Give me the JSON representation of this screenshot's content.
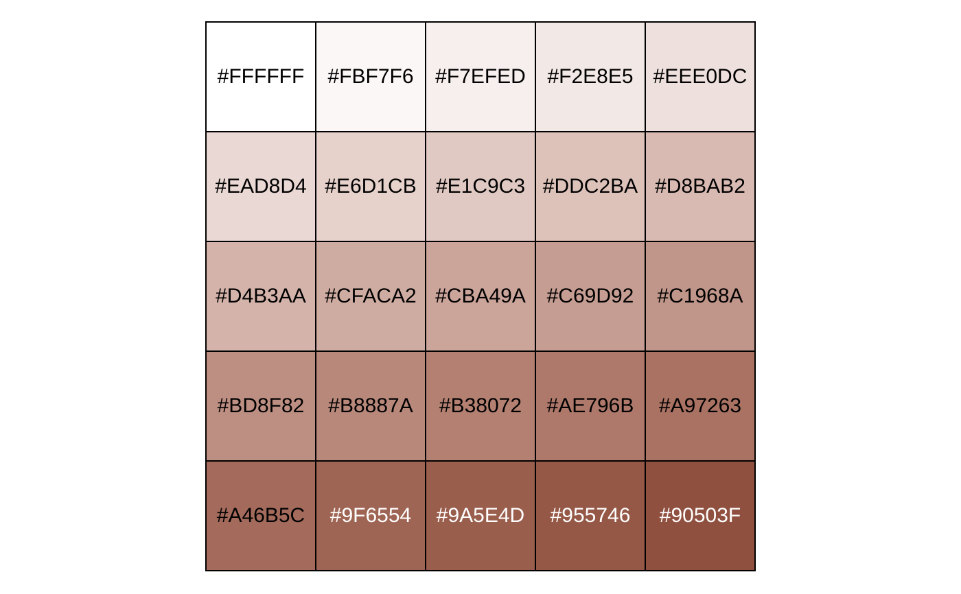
{
  "palette": {
    "swatches": [
      {
        "hex": "#FFFFFF",
        "text_color": "#000000"
      },
      {
        "hex": "#FBF7F6",
        "text_color": "#000000"
      },
      {
        "hex": "#F7EFED",
        "text_color": "#000000"
      },
      {
        "hex": "#F2E8E5",
        "text_color": "#000000"
      },
      {
        "hex": "#EEE0DC",
        "text_color": "#000000"
      },
      {
        "hex": "#EAD8D4",
        "text_color": "#000000"
      },
      {
        "hex": "#E6D1CB",
        "text_color": "#000000"
      },
      {
        "hex": "#E1C9C3",
        "text_color": "#000000"
      },
      {
        "hex": "#DDC2BA",
        "text_color": "#000000"
      },
      {
        "hex": "#D8BAB2",
        "text_color": "#000000"
      },
      {
        "hex": "#D4B3AA",
        "text_color": "#000000"
      },
      {
        "hex": "#CFACA2",
        "text_color": "#000000"
      },
      {
        "hex": "#CBA49A",
        "text_color": "#000000"
      },
      {
        "hex": "#C69D92",
        "text_color": "#000000"
      },
      {
        "hex": "#C1968A",
        "text_color": "#000000"
      },
      {
        "hex": "#BD8F82",
        "text_color": "#000000"
      },
      {
        "hex": "#B8887A",
        "text_color": "#000000"
      },
      {
        "hex": "#B38072",
        "text_color": "#000000"
      },
      {
        "hex": "#AE796B",
        "text_color": "#000000"
      },
      {
        "hex": "#A97263",
        "text_color": "#000000"
      },
      {
        "hex": "#A46B5C",
        "text_color": "#000000"
      },
      {
        "hex": "#9F6554",
        "text_color": "#FFFFFF"
      },
      {
        "hex": "#9A5E4D",
        "text_color": "#FFFFFF"
      },
      {
        "hex": "#955746",
        "text_color": "#FFFFFF"
      },
      {
        "hex": "#90503F",
        "text_color": "#FFFFFF"
      }
    ]
  }
}
